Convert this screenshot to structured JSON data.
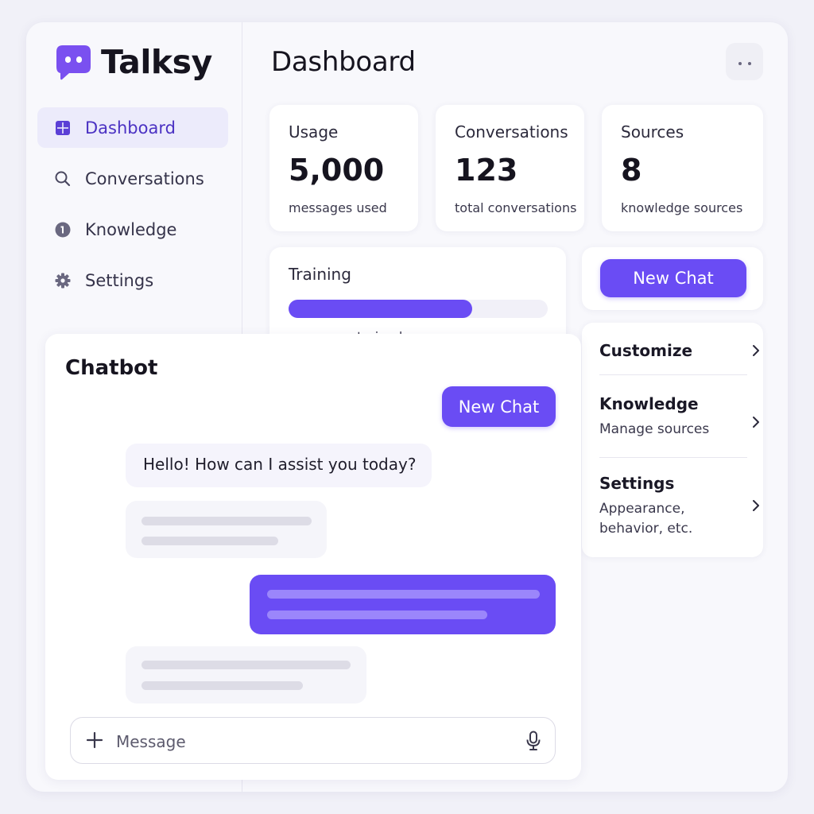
{
  "app": {
    "name": "Talksy",
    "accent": "#6a4cf4"
  },
  "sidebar": {
    "items": [
      {
        "label": "Dashboard",
        "icon": "grid-icon",
        "active": true
      },
      {
        "label": "Conversations",
        "icon": "search-icon",
        "active": false
      },
      {
        "label": "Knowledge",
        "icon": "knowledge-icon",
        "active": false
      },
      {
        "label": "Settings",
        "icon": "gear-icon",
        "active": false
      }
    ]
  },
  "header": {
    "title": "Dashboard",
    "menu_icon": "more-icon"
  },
  "stats": [
    {
      "label": "Usage",
      "value": "5,000",
      "sub": "messages used"
    },
    {
      "label": "Conversations",
      "value": "123",
      "sub": "total conversations"
    },
    {
      "label": "Sources",
      "value": "8",
      "sub": "knowledge sources"
    }
  ],
  "training": {
    "label": "Training",
    "progress": 0.71,
    "sub": "responses trained"
  },
  "new_chat_label": "New Chat",
  "quick_links": [
    {
      "title": "Customize",
      "sub": ""
    },
    {
      "title": "Knowledge",
      "sub": "Manage sources"
    },
    {
      "title": "Settings",
      "sub": "Appearance, behavior, etc."
    }
  ],
  "chatbot": {
    "title": "Chatbot",
    "new_chat_label": "New Chat",
    "greeting": "Hello! How can I assist you today?",
    "input_placeholder": "Message"
  }
}
